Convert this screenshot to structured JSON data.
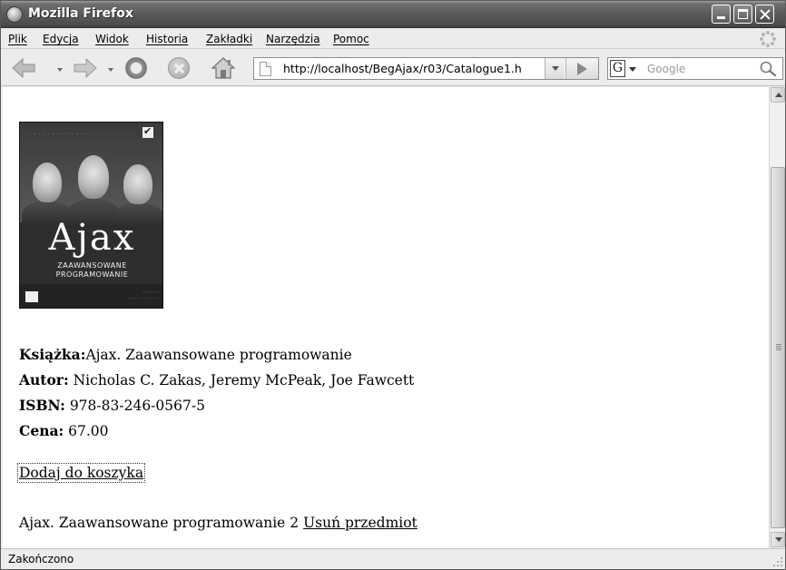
{
  "window": {
    "title": "Mozilla Firefox"
  },
  "menu": {
    "items": [
      "Plik",
      "Edycja",
      "Widok",
      "Historia",
      "Zakładki",
      "Narzędzia",
      "Pomoc"
    ]
  },
  "toolbar": {
    "url": "http://localhost/BegAjax/r03/Catalogue1.h",
    "search_placeholder": "Google",
    "search_engine_letter": "G"
  },
  "book": {
    "cover": {
      "title": "Ajax",
      "subtitle_line1": "ZAAWANSOWANE",
      "subtitle_line2": "PROGRAMOWANIE"
    },
    "title_label": "Książka:",
    "title_value": "Ajax. Zaawansowane programowanie",
    "author_label": "Autor:",
    "author_value": " Nicholas C. Zakas, Jeremy McPeak, Joe Fawcett",
    "isbn_label": "ISBN:",
    "isbn_value": " 978-83-246-0567-5",
    "price_label": "Cena:",
    "price_value": " 67.00"
  },
  "actions": {
    "add_to_cart": "Dodaj do koszyka"
  },
  "cart": {
    "item_text": "Ajax. Zaawansowane programowanie 2 ",
    "remove_label": "Usuń przedmiot"
  },
  "status": {
    "text": "Zakończono"
  }
}
